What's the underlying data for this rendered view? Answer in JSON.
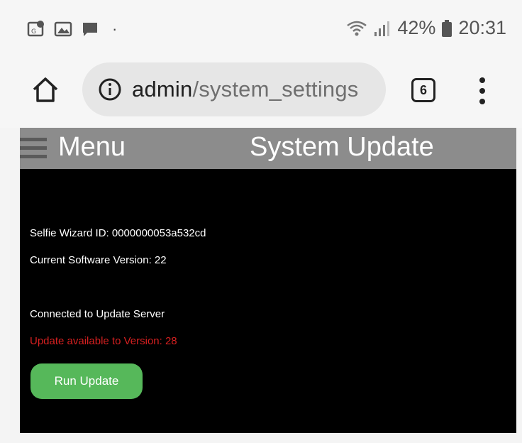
{
  "status_bar": {
    "notification_icons": [
      "location-photo-icon",
      "image-icon",
      "chat-icon"
    ],
    "dot": "·",
    "battery_percent": "42%",
    "time": "20:31"
  },
  "browser": {
    "url_host": "admin",
    "url_path": "/system_settings",
    "tab_count": "6"
  },
  "header": {
    "menu_label": "Menu",
    "title": "System Update"
  },
  "content": {
    "device_id_line": "Selfie Wizard ID: 0000000053a532cd",
    "version_line": "Current Software Version: 22",
    "server_status": "Connected to Update Server",
    "update_notice": "Update available to Version: 28",
    "run_button_label": "Run Update"
  },
  "colors": {
    "header_bg": "#8c8c8c",
    "content_bg": "#000000",
    "update_notice": "#d62020",
    "run_button": "#56b85a"
  }
}
